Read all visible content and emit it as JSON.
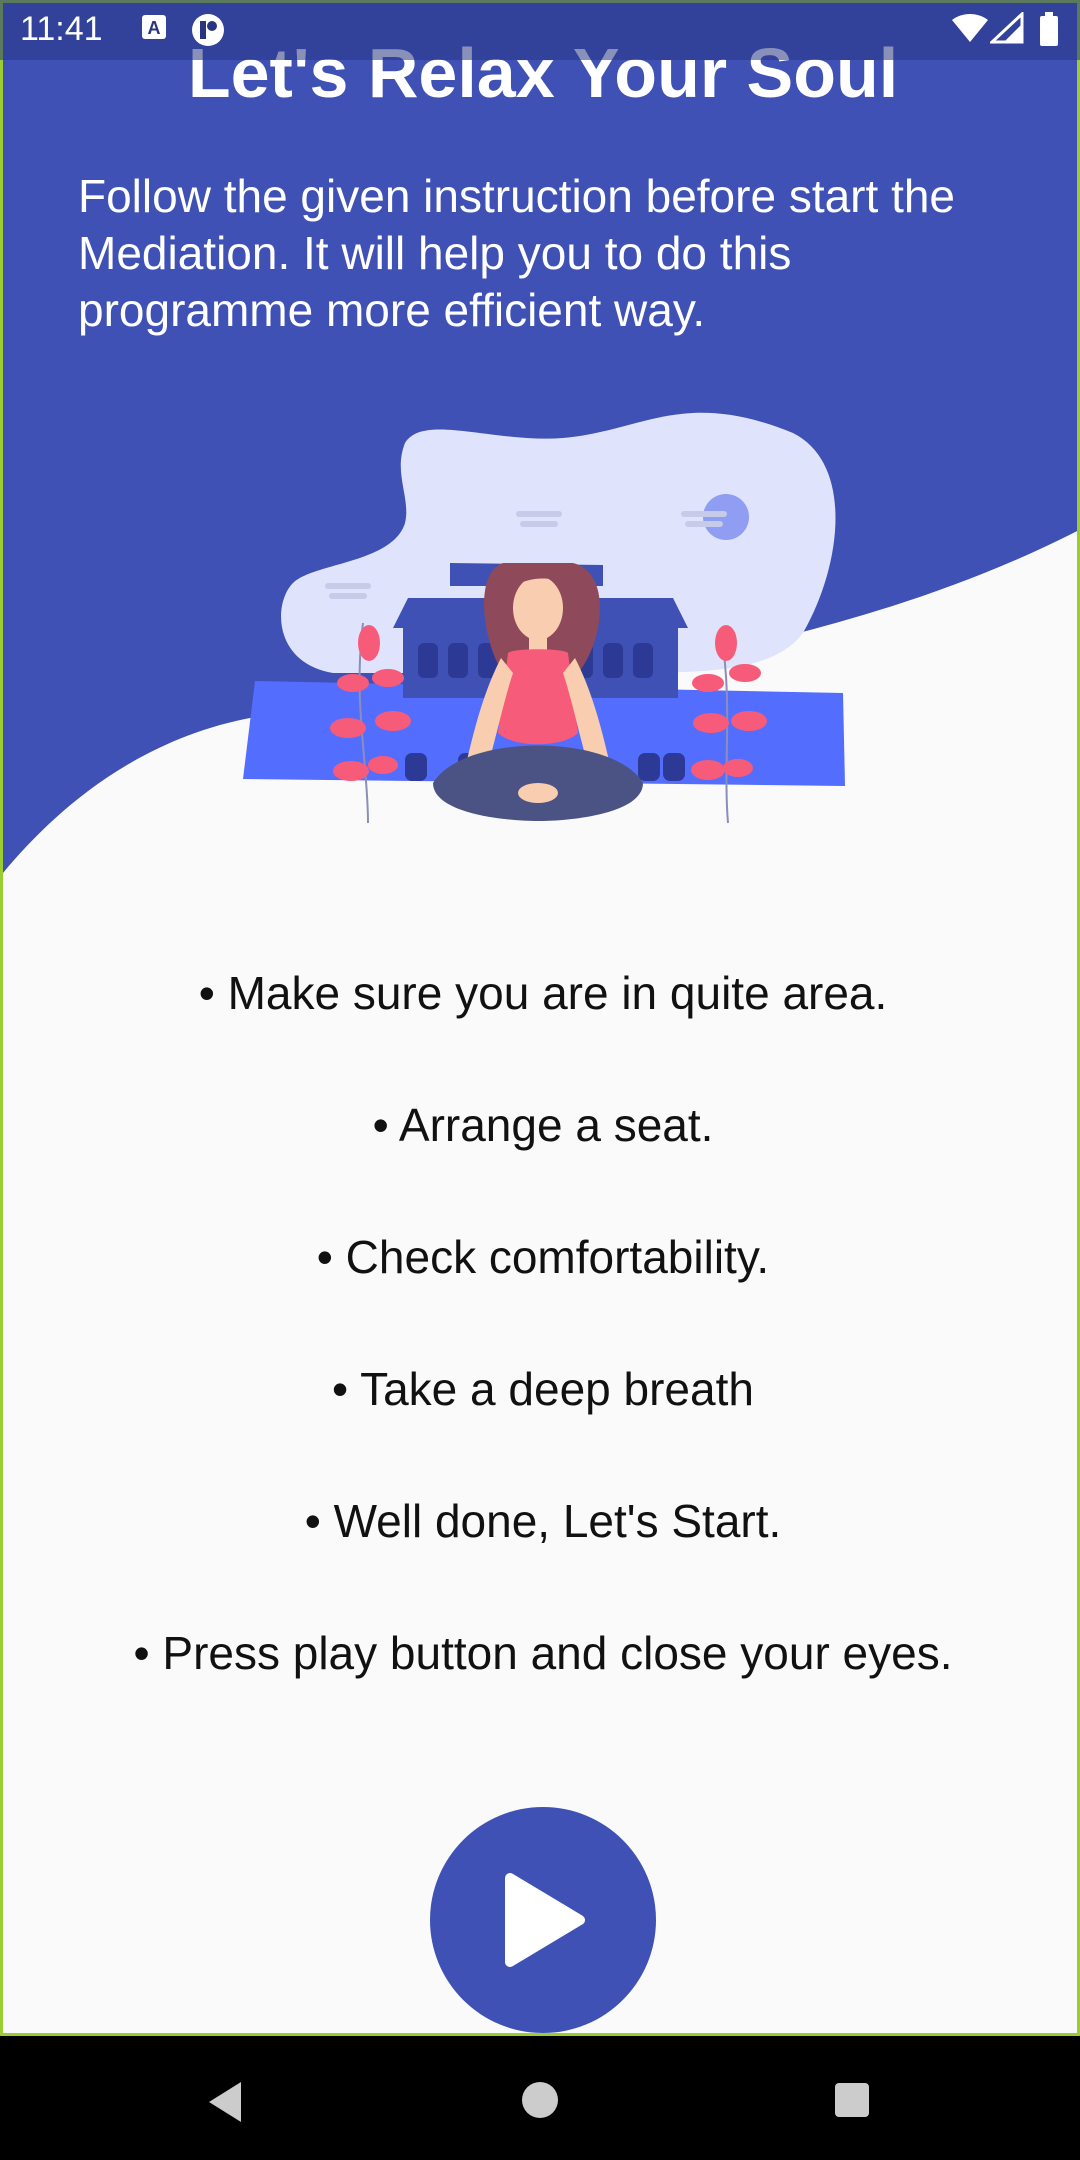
{
  "status_bar": {
    "time": "11:41",
    "icons": [
      "text-a-icon",
      "notification-app-icon",
      "wifi-icon",
      "signal-icon",
      "battery-icon"
    ]
  },
  "header": {
    "title": "Let's Relax Your Soul",
    "subtitle": "Follow the given instruction before start the Mediation. It will help you to do this programme more efficient way."
  },
  "steps": [
    "• Make sure you are in quite area.",
    "• Arrange a seat.",
    "• Check comfortability.",
    "• Take a deep breath",
    "• Well done, Let's Start.",
    "• Press play button and close your eyes."
  ],
  "play_button": {
    "icon": "play-icon"
  },
  "nav_bar": {
    "icons": [
      "back-icon",
      "home-icon",
      "recents-icon"
    ]
  },
  "colors": {
    "primary": "#3f51b5",
    "background": "#fafafa",
    "accent_pink": "#f75b7a",
    "blob": "#dfe3fb"
  }
}
